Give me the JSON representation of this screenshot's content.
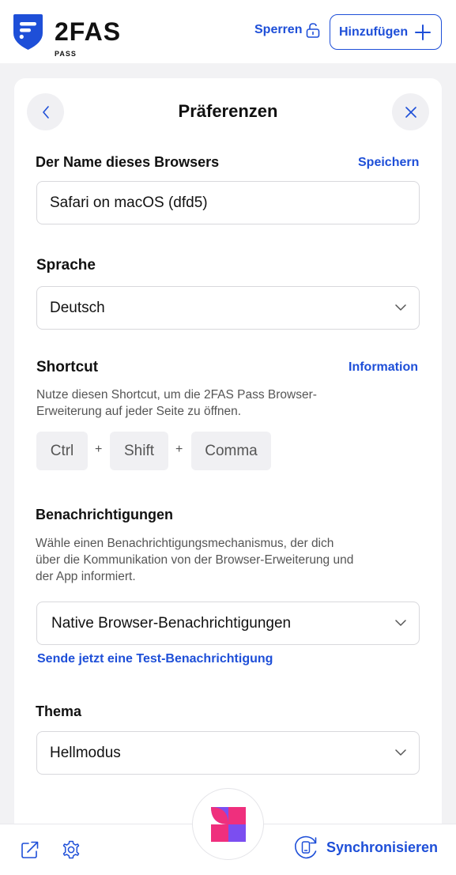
{
  "header": {
    "logo_text": "2FAS",
    "logo_subtext": "PASS",
    "lock_label": "Sperren",
    "add_label": "Hinzufügen"
  },
  "page": {
    "title": "Präferenzen"
  },
  "browser_name": {
    "label": "Der Name dieses Browsers",
    "save_label": "Speichern",
    "value": "Safari on macOS (dfd5)"
  },
  "language": {
    "label": "Sprache",
    "selected": "Deutsch"
  },
  "shortcut": {
    "label": "Shortcut",
    "info_label": "Information",
    "description_line1": "Nutze diesen Shortcut, um die 2FAS Pass Browser-",
    "description_line2": "Erweiterung auf jeder Seite zu öffnen.",
    "keys": [
      "Ctrl",
      "Shift",
      "Comma"
    ],
    "separator": "+"
  },
  "notifications": {
    "label": "Benachrichtigungen",
    "description_line1": "Wähle einen Benachrichtigungsmechanismus, der dich",
    "description_line2": "über die Kommunikation von der Browser-Erweiterung und",
    "description_line3": "der App informiert.",
    "selected": "Native Browser-Benachrichtigungen",
    "test_link": "Sende jetzt eine Test-Benachrichtigung"
  },
  "theme": {
    "label": "Thema",
    "selected": "Hellmodus"
  },
  "bottombar": {
    "sync_label": "Synchronisieren"
  },
  "colors": {
    "accent": "#1e4fd8",
    "logo_blue": "#1e4fd8",
    "brand_pink": "#ef2f7d",
    "brand_purple": "#7b4ef0"
  },
  "icons": [
    "shield-logo-icon",
    "lock-icon",
    "plus-icon",
    "chevron-left-icon",
    "close-icon",
    "chevron-down-icon",
    "share-icon",
    "gear-icon",
    "brand-icon",
    "sync-icon"
  ]
}
